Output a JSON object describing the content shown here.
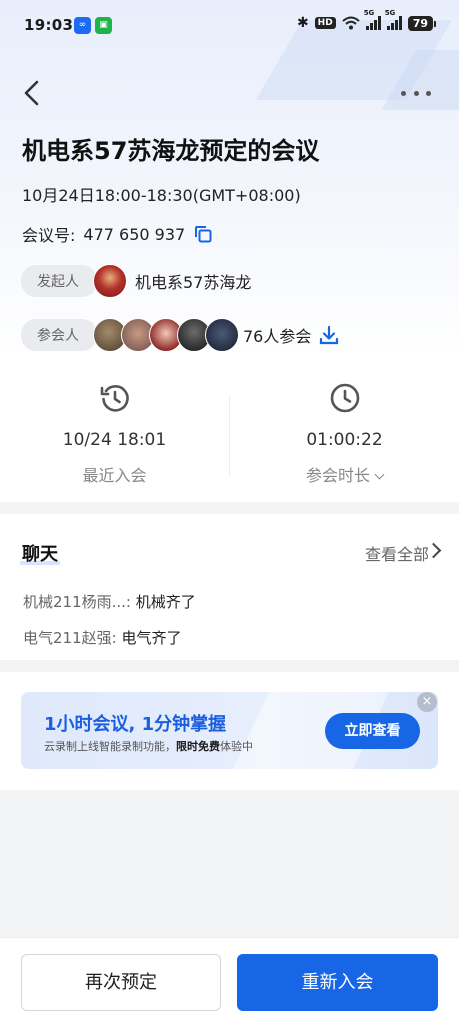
{
  "status_bar": {
    "time": "19:03",
    "app1": "∞",
    "app2": "▣",
    "hd": "HD",
    "battery": "79"
  },
  "meeting": {
    "title": "机电系57苏海龙预定的会议",
    "time_range": "10月24日18:00-18:30(GMT+08:00)",
    "id_label": "会议号:",
    "id_value": "477 650 937",
    "host_label": "发起人",
    "host_name": "机电系57苏海龙",
    "attendee_label": "参会人",
    "attendee_count": "76人参会"
  },
  "stats": {
    "last_join_value": "10/24 18:01",
    "last_join_label": "最近入会",
    "duration_value": "01:00:22",
    "duration_label": "参会时长"
  },
  "chat": {
    "title": "聊天",
    "view_all": "查看全部",
    "messages": [
      {
        "sender": "机械211杨雨...:",
        "text": "机械齐了"
      },
      {
        "sender": "电气211赵强:",
        "text": "电气齐了"
      }
    ]
  },
  "promo": {
    "title": "1小时会议, 1分钟掌握",
    "sub_prefix": "云录制上线智能录制功能，",
    "sub_bold": "限时免费",
    "sub_suffix": "体验中",
    "button": "立即查看",
    "close": "×"
  },
  "actions": {
    "reschedule": "再次预定",
    "rejoin": "重新入会"
  },
  "colors": {
    "primary": "#1766e6",
    "promo_title": "#1b5fe0"
  }
}
